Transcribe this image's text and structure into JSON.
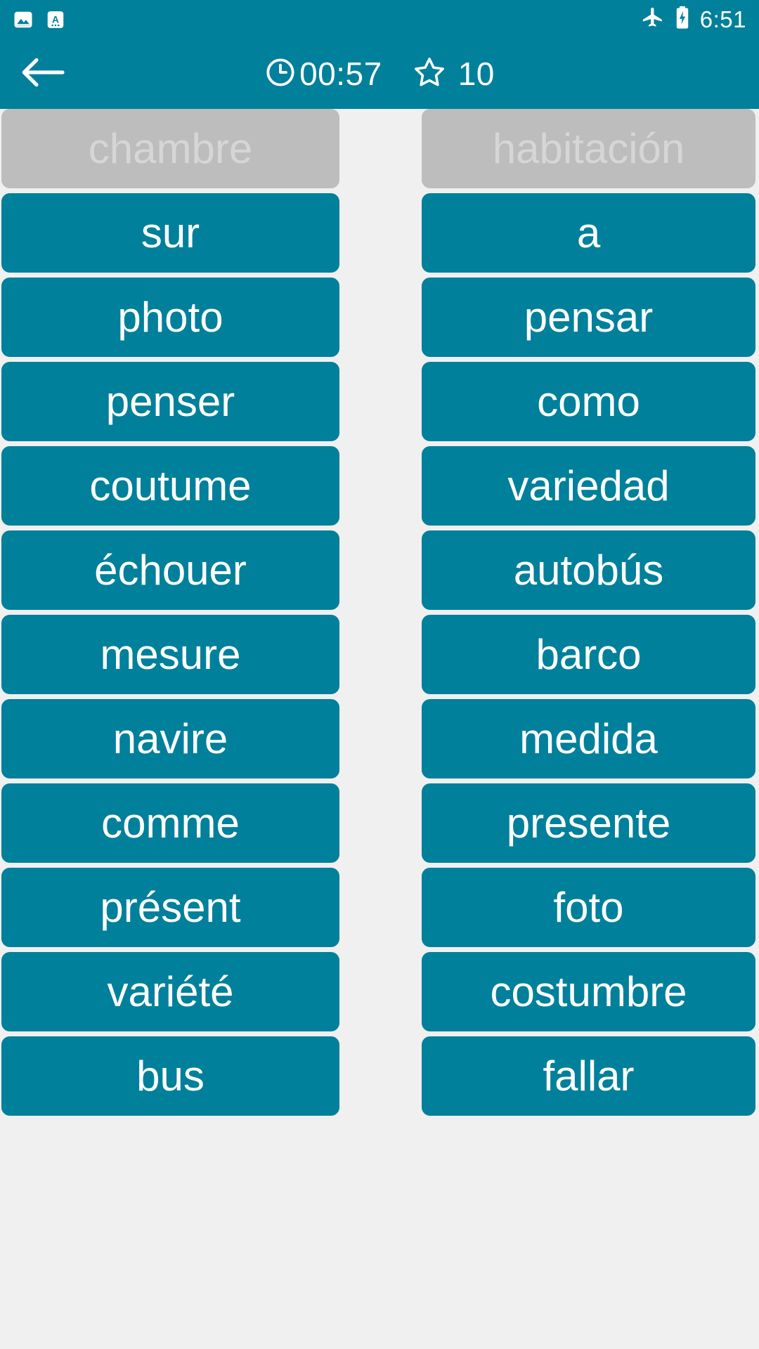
{
  "status_bar": {
    "notifications": [
      {
        "icon": "image-notification-icon"
      },
      {
        "icon": "text-input-notification-icon"
      }
    ],
    "airplane_icon": "airplane-mode-icon",
    "battery_icon": "battery-charging-icon",
    "time": "6:51"
  },
  "toolbar": {
    "back_icon": "back-arrow-icon",
    "timer_icon": "clock-icon",
    "timer": "00:57",
    "star_icon": "star-outline-icon",
    "stars": "10"
  },
  "colors": {
    "accent_teal": "#00809b",
    "matched_gray": "#bdbdbd",
    "matched_text": "#d6d6d6",
    "background": "#f0f0f0",
    "on_accent_text": "#ffffff"
  },
  "board": {
    "left_column": [
      {
        "label": "chambre",
        "state": "matched"
      },
      {
        "label": "sur",
        "state": "active"
      },
      {
        "label": "photo",
        "state": "active"
      },
      {
        "label": "penser",
        "state": "active"
      },
      {
        "label": "coutume",
        "state": "active"
      },
      {
        "label": "échouer",
        "state": "active"
      },
      {
        "label": "mesure",
        "state": "active"
      },
      {
        "label": "navire",
        "state": "active"
      },
      {
        "label": "comme",
        "state": "active"
      },
      {
        "label": "présent",
        "state": "active"
      },
      {
        "label": "variété",
        "state": "active"
      },
      {
        "label": "bus",
        "state": "active"
      }
    ],
    "right_column": [
      {
        "label": "habitación",
        "state": "matched"
      },
      {
        "label": "a",
        "state": "active"
      },
      {
        "label": "pensar",
        "state": "active"
      },
      {
        "label": "como",
        "state": "active"
      },
      {
        "label": "variedad",
        "state": "active"
      },
      {
        "label": "autobús",
        "state": "active"
      },
      {
        "label": "barco",
        "state": "active"
      },
      {
        "label": "medida",
        "state": "active"
      },
      {
        "label": "presente",
        "state": "active"
      },
      {
        "label": "foto",
        "state": "active"
      },
      {
        "label": "costumbre",
        "state": "active"
      },
      {
        "label": "fallar",
        "state": "active"
      }
    ]
  }
}
